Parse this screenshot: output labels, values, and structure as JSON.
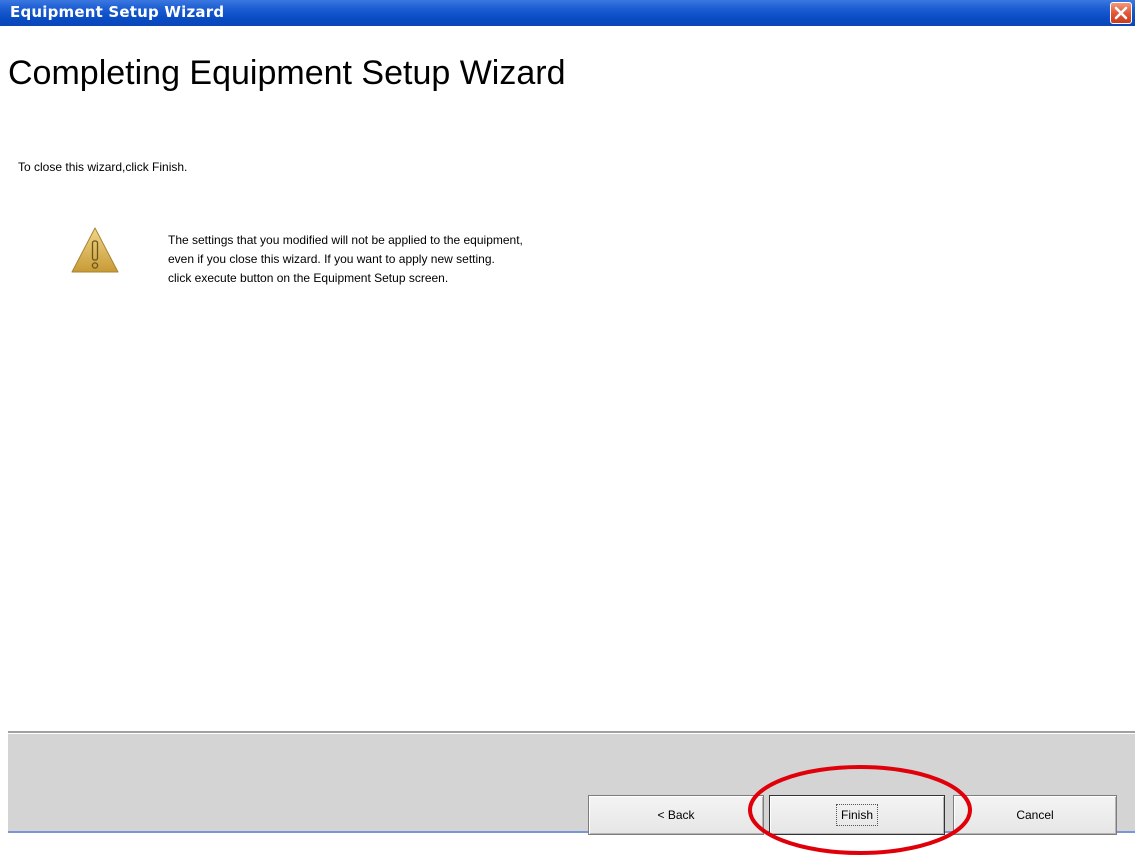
{
  "window": {
    "title": "Equipment Setup Wizard"
  },
  "page": {
    "heading": "Completing Equipment Setup Wizard",
    "instruction": "To close this wizard,click Finish.",
    "warning": {
      "icon": "warning-icon",
      "lines": [
        "The settings that you modified will not be applied to the equipment,",
        "even if you close this wizard. If you want to apply new setting.",
        "click execute button on the Equipment Setup screen."
      ]
    }
  },
  "buttons": {
    "back_label": "< Back",
    "finish_label": "Finish",
    "cancel_label": "Cancel"
  },
  "colors": {
    "titlebar": "#0a4cc4",
    "close_button": "#e2573a",
    "highlight_annotation": "#e0000a",
    "warning_icon": "#d4b04a"
  },
  "annotation": {
    "type": "circle",
    "target": "finish-button"
  }
}
